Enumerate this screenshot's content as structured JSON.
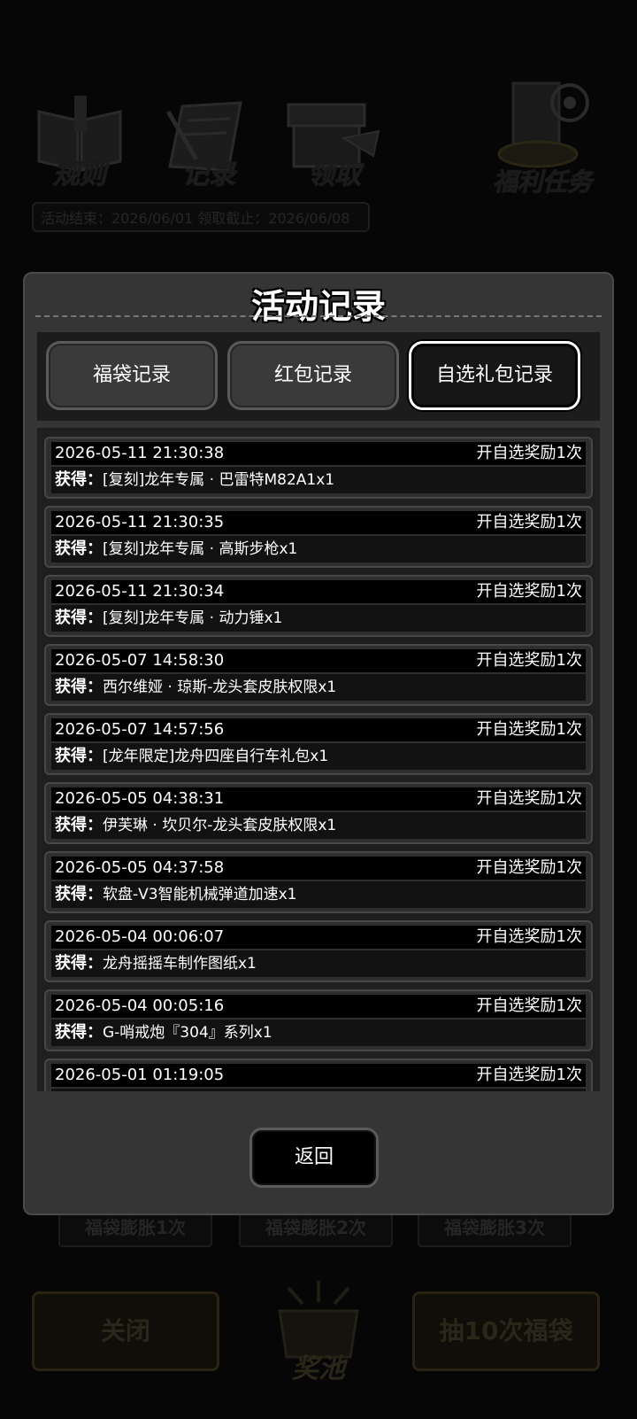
{
  "background": {
    "top_icons": [
      {
        "label": "规则",
        "icon": "book-icon"
      },
      {
        "label": "记录",
        "icon": "notepad-icon"
      },
      {
        "label": "领取",
        "icon": "gift-box-icon"
      },
      {
        "label": "福利任务",
        "icon": "target-trophy-icon"
      }
    ],
    "dates": "活动结束：2026/06/01  领取截止：2026/06/08",
    "boosts": [
      "福袋膨胀1次",
      "福袋膨胀2次",
      "福袋膨胀3次"
    ],
    "close_label": "关闭",
    "pool_label": "奖池",
    "draw10_label": "抽10次福袋"
  },
  "modal": {
    "title": "活动记录",
    "tabs": [
      "福袋记录",
      "红包记录",
      "自选礼包记录"
    ],
    "active_tab": 2,
    "gain_label": "获得：",
    "records": [
      {
        "time": "2026-05-11 21:30:38",
        "type": "开自选奖励1次",
        "item": "[复刻]龙年专属 · 巴雷特M82A1x1"
      },
      {
        "time": "2026-05-11 21:30:35",
        "type": "开自选奖励1次",
        "item": "[复刻]龙年专属 · 高斯步枪x1"
      },
      {
        "time": "2026-05-11 21:30:34",
        "type": "开自选奖励1次",
        "item": "[复刻]龙年专属 · 动力锤x1"
      },
      {
        "time": "2026-05-07 14:58:30",
        "type": "开自选奖励1次",
        "item": "西尔维娅 · 琼斯-龙头套皮肤权限x1"
      },
      {
        "time": "2026-05-07 14:57:56",
        "type": "开自选奖励1次",
        "item": "[龙年限定]龙舟四座自行车礼包x1"
      },
      {
        "time": "2026-05-05 04:38:31",
        "type": "开自选奖励1次",
        "item": "伊芙琳 · 坎贝尔-龙头套皮肤权限x1"
      },
      {
        "time": "2026-05-05 04:37:58",
        "type": "开自选奖励1次",
        "item": "软盘-V3智能机械弹道加速x1"
      },
      {
        "time": "2026-05-04 00:06:07",
        "type": "开自选奖励1次",
        "item": "龙舟摇摇车制作图纸x1"
      },
      {
        "time": "2026-05-04 00:05:16",
        "type": "开自选奖励1次",
        "item": "G-哨戒炮『304』系列x1"
      },
      {
        "time": "2026-05-01 01:19:05",
        "type": "开自选奖励1次",
        "item": ""
      }
    ],
    "back_label": "返回"
  }
}
